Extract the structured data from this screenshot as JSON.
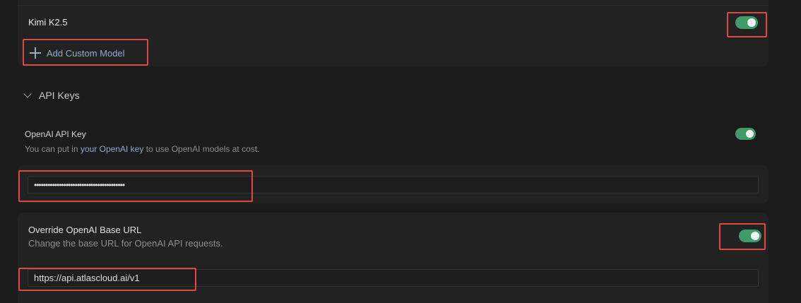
{
  "models": {
    "item_name": "Kimi K2.5",
    "enabled": true,
    "add_custom_label": "Add Custom Model"
  },
  "api_keys": {
    "section_title": "API Keys",
    "openai": {
      "label": "OpenAI API Key",
      "desc_prefix": "You can put in ",
      "desc_link": "your OpenAI key",
      "desc_suffix": " to use OpenAI models at cost.",
      "enabled": true,
      "value": "••••••••••••••••••••••••••••••••••••••••"
    },
    "override": {
      "label": "Override OpenAI Base URL",
      "desc": "Change the base URL for OpenAI API requests.",
      "enabled": true,
      "value": "https://api.atlascloud.ai/v1"
    }
  },
  "colors": {
    "toggle_on": "#3e9c68",
    "highlight": "#e0483d",
    "link": "#8fa9d6"
  }
}
